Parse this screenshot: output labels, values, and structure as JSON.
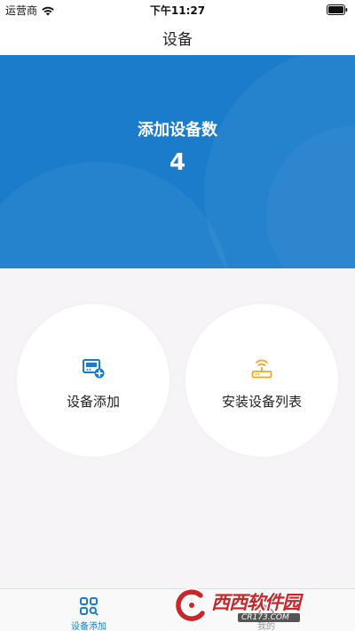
{
  "status_bar": {
    "carrier": "运营商",
    "time": "下午11:27"
  },
  "nav": {
    "title": "设备"
  },
  "hero": {
    "label": "添加设备数",
    "count": "4"
  },
  "actions": [
    {
      "label": "设备添加",
      "icon": "device-add-icon",
      "color": "#1a7ccb"
    },
    {
      "label": "安装设备列表",
      "icon": "router-icon",
      "color": "#f0a623"
    }
  ],
  "tabs": [
    {
      "label": "设备添加",
      "icon": "grid-search-icon",
      "active": true
    },
    {
      "label": "我的",
      "icon": "person-icon",
      "active": false
    }
  ],
  "watermark": {
    "title": "西西软件园",
    "subtitle": "CR173.COM"
  },
  "colors": {
    "primary": "#1a7ccb",
    "accent": "#f0a623",
    "background": "#f7f4f7"
  }
}
